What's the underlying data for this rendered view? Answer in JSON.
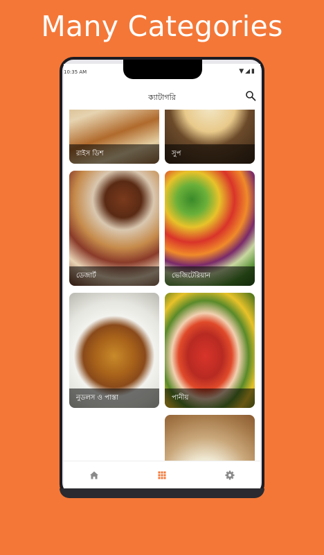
{
  "promo": {
    "headline": "Many Categories"
  },
  "status": {
    "time": "10:35 AM"
  },
  "appbar": {
    "title": "ক্যাটাগরি"
  },
  "categories": [
    {
      "label": "রাইস ডিশ"
    },
    {
      "label": "সুপ"
    },
    {
      "label": "ডেজার্ট"
    },
    {
      "label": "ভেজিটেরিয়ান"
    },
    {
      "label": "নুডলস ও পাস্তা"
    },
    {
      "label": "পানীয়"
    },
    {
      "label": ""
    },
    {
      "label": ""
    }
  ],
  "bottom_nav": [
    {
      "icon": "home-icon",
      "active": false
    },
    {
      "icon": "grid-icon",
      "active": true
    },
    {
      "icon": "settings-icon",
      "active": false
    }
  ],
  "colors": {
    "accent": "#F47737",
    "background": "#F47737",
    "nav_inactive": "#8a8a8a"
  }
}
